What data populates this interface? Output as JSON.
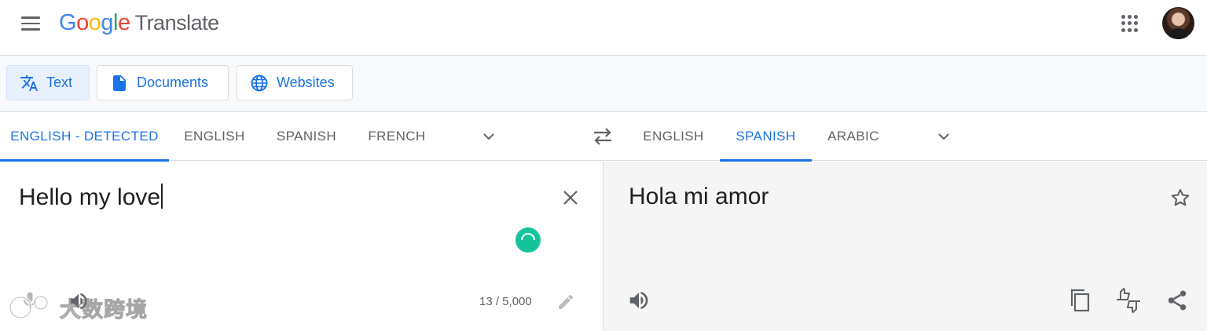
{
  "header": {
    "logo_letters": [
      "G",
      "o",
      "o",
      "g",
      "l",
      "e"
    ],
    "product_name": "Translate",
    "icons": {
      "menu": "hamburger-menu-icon",
      "apps": "apps-grid-icon",
      "account": "account-avatar"
    }
  },
  "modes": [
    {
      "label": "Text",
      "icon": "translate-icon",
      "active": true
    },
    {
      "label": "Documents",
      "icon": "document-icon",
      "active": false
    },
    {
      "label": "Websites",
      "icon": "globe-icon",
      "active": false
    }
  ],
  "source_languages": [
    {
      "label": "ENGLISH - DETECTED",
      "active": true
    },
    {
      "label": "ENGLISH",
      "active": false
    },
    {
      "label": "SPANISH",
      "active": false
    },
    {
      "label": "FRENCH",
      "active": false
    }
  ],
  "target_languages": [
    {
      "label": "ENGLISH",
      "active": false
    },
    {
      "label": "SPANISH",
      "active": true
    },
    {
      "label": "ARABIC",
      "active": false
    }
  ],
  "source": {
    "text": "Hello my love",
    "char_count": "13 / 5,000"
  },
  "target": {
    "text": "Hola mi amor"
  },
  "watermark": {
    "text": "大数跨境"
  },
  "colors": {
    "accent": "#1a73e8",
    "grammar_badge": "#15c39a",
    "target_panel_bg": "#f5f5f5"
  }
}
